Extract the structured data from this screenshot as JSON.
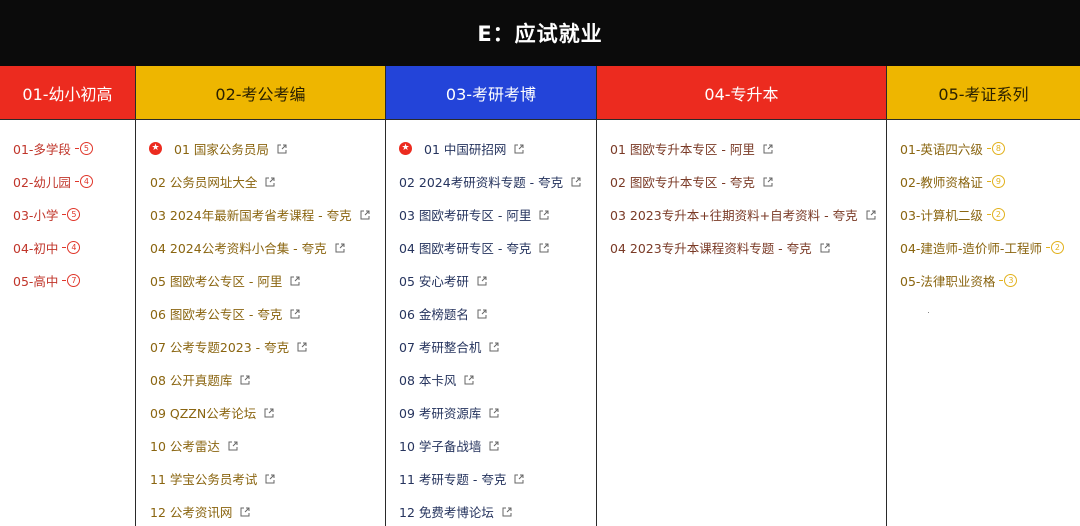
{
  "title": "E：应试就业",
  "columns": [
    {
      "header": "01-幼小初高",
      "items": [
        {
          "label": "01-多学段",
          "badge": "5"
        },
        {
          "label": "02-幼儿园",
          "badge": "4"
        },
        {
          "label": "03-小学",
          "badge": "5"
        },
        {
          "label": "04-初中",
          "badge": "4"
        },
        {
          "label": "05-高中",
          "badge": "7"
        }
      ]
    },
    {
      "header": "02-考公考编",
      "items": [
        {
          "label": "01 国家公务员局"
        },
        {
          "label": "02 公务员网址大全"
        },
        {
          "label": "03 2024年最新国考省考课程 - 夸克"
        },
        {
          "label": "04 2024公考资料小合集 - 夸克"
        },
        {
          "label": "05 图欧考公专区 - 阿里"
        },
        {
          "label": "06 图欧考公专区 - 夸克"
        },
        {
          "label": "07 公考专题2023 - 夸克"
        },
        {
          "label": "08 公开真题库"
        },
        {
          "label": "09 QZZN公考论坛"
        },
        {
          "label": "10 公考雷达"
        },
        {
          "label": "11 学宝公务员考试"
        },
        {
          "label": "12 公考资讯网"
        }
      ]
    },
    {
      "header": "03-考研考博",
      "items": [
        {
          "label": "01 中国研招网"
        },
        {
          "label": "02 2024考研资料专题 - 夸克"
        },
        {
          "label": "03 图欧考研专区 - 阿里"
        },
        {
          "label": "04 图欧考研专区 - 夸克"
        },
        {
          "label": "05 安心考研"
        },
        {
          "label": "06 金榜题名"
        },
        {
          "label": "07 考研整合机"
        },
        {
          "label": "08 本卡风"
        },
        {
          "label": "09 考研资源库"
        },
        {
          "label": "10 学子备战墙"
        },
        {
          "label": "11 考研专题 - 夸克"
        },
        {
          "label": "12 免费考博论坛"
        }
      ]
    },
    {
      "header": "04-专升本",
      "items": [
        {
          "label": "01 图欧专升本专区 - 阿里"
        },
        {
          "label": "02 图欧专升本专区 - 夸克"
        },
        {
          "label": "03 2023专升本+往期资料+自考资料 - 夸克"
        },
        {
          "label": "04 2023专升本课程资料专题 - 夸克"
        }
      ]
    },
    {
      "header": "05-考证系列",
      "items": [
        {
          "label": "01-英语四六级",
          "badge": "8"
        },
        {
          "label": "02-教师资格证",
          "badge": "9"
        },
        {
          "label": "03-计算机二级",
          "badge": "2"
        },
        {
          "label": "04-建造师-造价师-工程师",
          "badge": "2"
        },
        {
          "label": "05-法律职业资格",
          "badge": "3"
        }
      ]
    }
  ],
  "colors": {
    "red": "#ec2b1f",
    "yellow": "#eeb600",
    "blue": "#2344d9",
    "black": "#0b0b0b"
  }
}
